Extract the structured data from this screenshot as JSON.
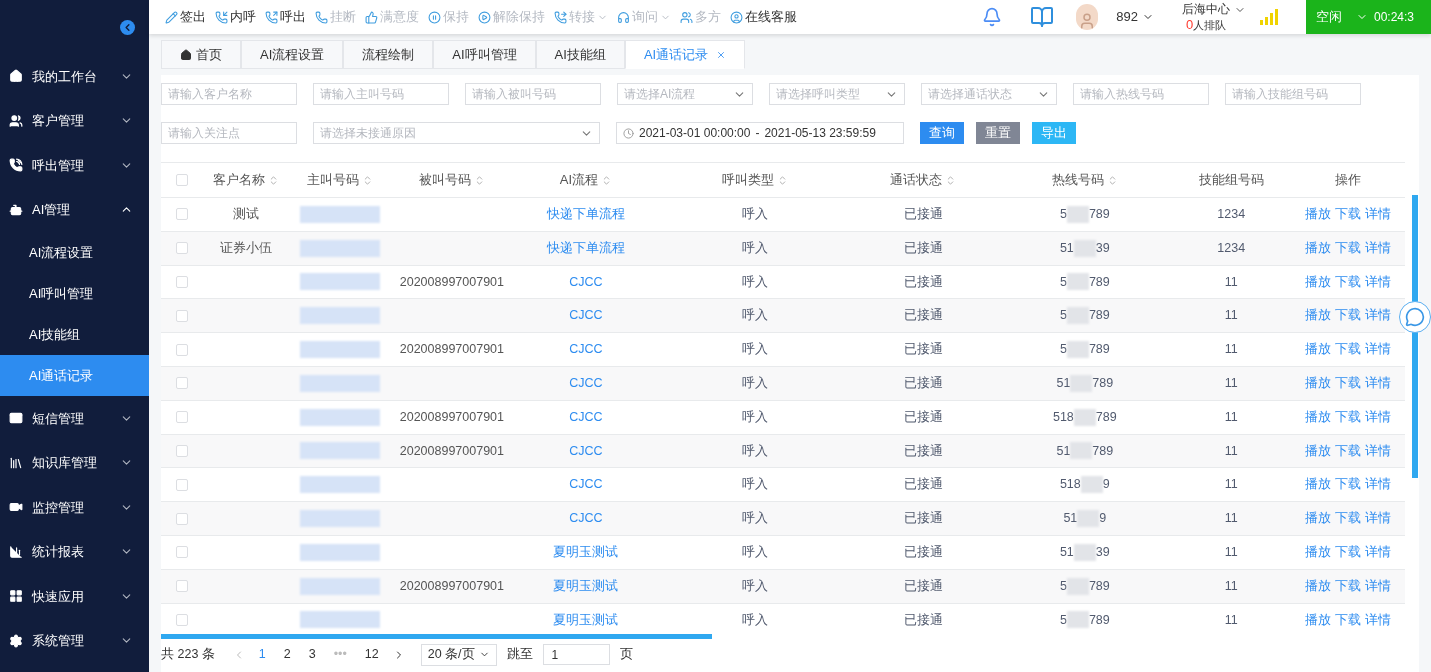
{
  "toolbar": [
    {
      "label": "签出",
      "disabled": false,
      "dropdown": false
    },
    {
      "label": "内呼",
      "disabled": false,
      "dropdown": false
    },
    {
      "label": "呼出",
      "disabled": false,
      "dropdown": false
    },
    {
      "label": "挂断",
      "disabled": true,
      "dropdown": false
    },
    {
      "label": "满意度",
      "disabled": true,
      "dropdown": false
    },
    {
      "label": "保持",
      "disabled": true,
      "dropdown": false
    },
    {
      "label": "解除保持",
      "disabled": true,
      "dropdown": false
    },
    {
      "label": "转接",
      "disabled": true,
      "dropdown": true
    },
    {
      "label": "询问",
      "disabled": true,
      "dropdown": true
    },
    {
      "label": "多方",
      "disabled": true,
      "dropdown": false
    },
    {
      "label": "在线客服",
      "disabled": false,
      "dropdown": false
    }
  ],
  "agent": {
    "extension": "892",
    "group": "后海中心",
    "queue_count": "0",
    "queue_label": "人排队",
    "status": "空闲",
    "timer": "00:24:3"
  },
  "sidebar": [
    {
      "label": "我的工作台",
      "expanded": false
    },
    {
      "label": "客户管理",
      "expanded": false
    },
    {
      "label": "呼出管理",
      "expanded": false
    },
    {
      "label": "AI管理",
      "expanded": true,
      "children": [
        {
          "label": "AI流程设置",
          "selected": false
        },
        {
          "label": "AI呼叫管理",
          "selected": false
        },
        {
          "label": "AI技能组",
          "selected": false
        },
        {
          "label": "AI通话记录",
          "selected": true
        }
      ]
    },
    {
      "label": "短信管理",
      "expanded": false
    },
    {
      "label": "知识库管理",
      "expanded": false
    },
    {
      "label": "监控管理",
      "expanded": false
    },
    {
      "label": "统计报表",
      "expanded": false
    },
    {
      "label": "快速应用",
      "expanded": false
    },
    {
      "label": "系统管理",
      "expanded": false
    }
  ],
  "tabs": [
    {
      "label": "首页",
      "selected": false,
      "closable": false
    },
    {
      "label": "AI流程设置",
      "selected": false,
      "closable": false
    },
    {
      "label": "流程绘制",
      "selected": false,
      "closable": false
    },
    {
      "label": "AI呼叫管理",
      "selected": false,
      "closable": false
    },
    {
      "label": "AI技能组",
      "selected": false,
      "closable": false
    },
    {
      "label": "AI通话记录",
      "selected": true,
      "closable": true
    }
  ],
  "filters": [
    {
      "kind": "input",
      "placeholder": "请输入客户名称"
    },
    {
      "kind": "input",
      "placeholder": "请输入主叫号码"
    },
    {
      "kind": "input",
      "placeholder": "请输入被叫号码"
    },
    {
      "kind": "select",
      "placeholder": "请选择AI流程"
    },
    {
      "kind": "select",
      "placeholder": "请选择呼叫类型"
    },
    {
      "kind": "select",
      "placeholder": "请选择通话状态"
    },
    {
      "kind": "input",
      "placeholder": "请输入热线号码"
    },
    {
      "kind": "input",
      "placeholder": "请输入技能组号码"
    },
    {
      "kind": "input",
      "placeholder": "请输入关注点"
    },
    {
      "kind": "wide-select",
      "placeholder": "请选择未接通原因"
    },
    {
      "kind": "daterange",
      "start": "2021-03-01 00:00:00",
      "separator": "-",
      "end": "2021-05-13 23:59:59"
    }
  ],
  "buttons": [
    {
      "kind": "primary",
      "label": "查询"
    },
    {
      "kind": "reset",
      "label": "重置"
    },
    {
      "kind": "export",
      "label": "导出"
    }
  ],
  "table": {
    "all_checked": false,
    "columns": [
      {
        "label": "客户名称",
        "sortable": true
      },
      {
        "label": "主叫号码",
        "sortable": true
      },
      {
        "label": "被叫号码",
        "sortable": true
      },
      {
        "label": "AI流程",
        "sortable": true
      },
      {
        "label": "呼叫类型",
        "sortable": true
      },
      {
        "label": "通话状态",
        "sortable": true
      },
      {
        "label": "热线号码",
        "sortable": true
      },
      {
        "label": "技能组号码",
        "sortable": false
      },
      {
        "label": "操作",
        "sortable": false
      }
    ],
    "rows": [
      {
        "checked": false,
        "customer": "测试",
        "callee": "",
        "flow": "快递下单流程",
        "call_type": "呼入",
        "status": "已接通",
        "hotline_start": "5",
        "hotline_end": "789",
        "group": "1234",
        "actions": [
          "播放",
          "下载",
          "详情"
        ]
      },
      {
        "checked": false,
        "customer": "证券小伍",
        "callee": "",
        "flow": "快递下单流程",
        "call_type": "呼入",
        "status": "已接通",
        "hotline_start": "51",
        "hotline_end": "39",
        "group": "1234",
        "actions": [
          "播放",
          "下载",
          "详情"
        ]
      },
      {
        "checked": false,
        "customer": "",
        "callee": "202008997007901",
        "flow": "CJCC",
        "call_type": "呼入",
        "status": "已接通",
        "hotline_start": "5",
        "hotline_end": "789",
        "group": "11",
        "actions": [
          "播放",
          "下载",
          "详情"
        ]
      },
      {
        "checked": false,
        "customer": "",
        "callee": "",
        "flow": "CJCC",
        "call_type": "呼入",
        "status": "已接通",
        "hotline_start": "5",
        "hotline_end": "789",
        "group": "11",
        "actions": [
          "播放",
          "下载",
          "详情"
        ]
      },
      {
        "checked": false,
        "customer": "",
        "callee": "202008997007901",
        "flow": "CJCC",
        "call_type": "呼入",
        "status": "已接通",
        "hotline_start": "5",
        "hotline_end": "789",
        "group": "11",
        "actions": [
          "播放",
          "下载",
          "详情"
        ]
      },
      {
        "checked": false,
        "customer": "",
        "callee": "",
        "flow": "CJCC",
        "call_type": "呼入",
        "status": "已接通",
        "hotline_start": "51",
        "hotline_end": "789",
        "group": "11",
        "actions": [
          "播放",
          "下载",
          "详情"
        ]
      },
      {
        "checked": false,
        "customer": "",
        "callee": "202008997007901",
        "flow": "CJCC",
        "call_type": "呼入",
        "status": "已接通",
        "hotline_start": "518",
        "hotline_end": "789",
        "group": "11",
        "actions": [
          "播放",
          "下载",
          "详情"
        ]
      },
      {
        "checked": false,
        "customer": "",
        "callee": "202008997007901",
        "flow": "CJCC",
        "call_type": "呼入",
        "status": "已接通",
        "hotline_start": "51",
        "hotline_end": "789",
        "group": "11",
        "actions": [
          "播放",
          "下载",
          "详情"
        ]
      },
      {
        "checked": false,
        "customer": "",
        "callee": "",
        "flow": "CJCC",
        "call_type": "呼入",
        "status": "已接通",
        "hotline_start": "518",
        "hotline_end": "9",
        "group": "11",
        "actions": [
          "播放",
          "下载",
          "详情"
        ]
      },
      {
        "checked": false,
        "customer": "",
        "callee": "",
        "flow": "CJCC",
        "call_type": "呼入",
        "status": "已接通",
        "hotline_start": "51",
        "hotline_end": "9",
        "group": "11",
        "actions": [
          "播放",
          "下载",
          "详情"
        ]
      },
      {
        "checked": false,
        "customer": "",
        "callee": "",
        "flow": "夏明玉测试",
        "call_type": "呼入",
        "status": "已接通",
        "hotline_start": "51",
        "hotline_end": "39",
        "group": "11",
        "actions": [
          "播放",
          "下载",
          "详情"
        ]
      },
      {
        "checked": false,
        "customer": "",
        "callee": "202008997007901",
        "flow": "夏明玉测试",
        "call_type": "呼入",
        "status": "已接通",
        "hotline_start": "5",
        "hotline_end": "789",
        "group": "11",
        "actions": [
          "播放",
          "下载",
          "详情"
        ]
      },
      {
        "checked": false,
        "customer": "",
        "callee": "",
        "flow": "夏明玉测试",
        "call_type": "呼入",
        "status": "已接通",
        "hotline_start": "5",
        "hotline_end": "789",
        "group": "11",
        "actions": [
          "播放",
          "下载",
          "详情"
        ]
      }
    ]
  },
  "pagination": {
    "total": "共 223 条",
    "pages": [
      {
        "label": "1",
        "selected": true
      },
      {
        "label": "2",
        "selected": false
      },
      {
        "label": "3",
        "selected": false
      },
      {
        "label": "•••",
        "selected": false
      },
      {
        "label": "12",
        "selected": false
      }
    ],
    "page_size": "20 条/页",
    "jump_label": "跳至",
    "jump_value": "1",
    "page_suffix": "页"
  }
}
